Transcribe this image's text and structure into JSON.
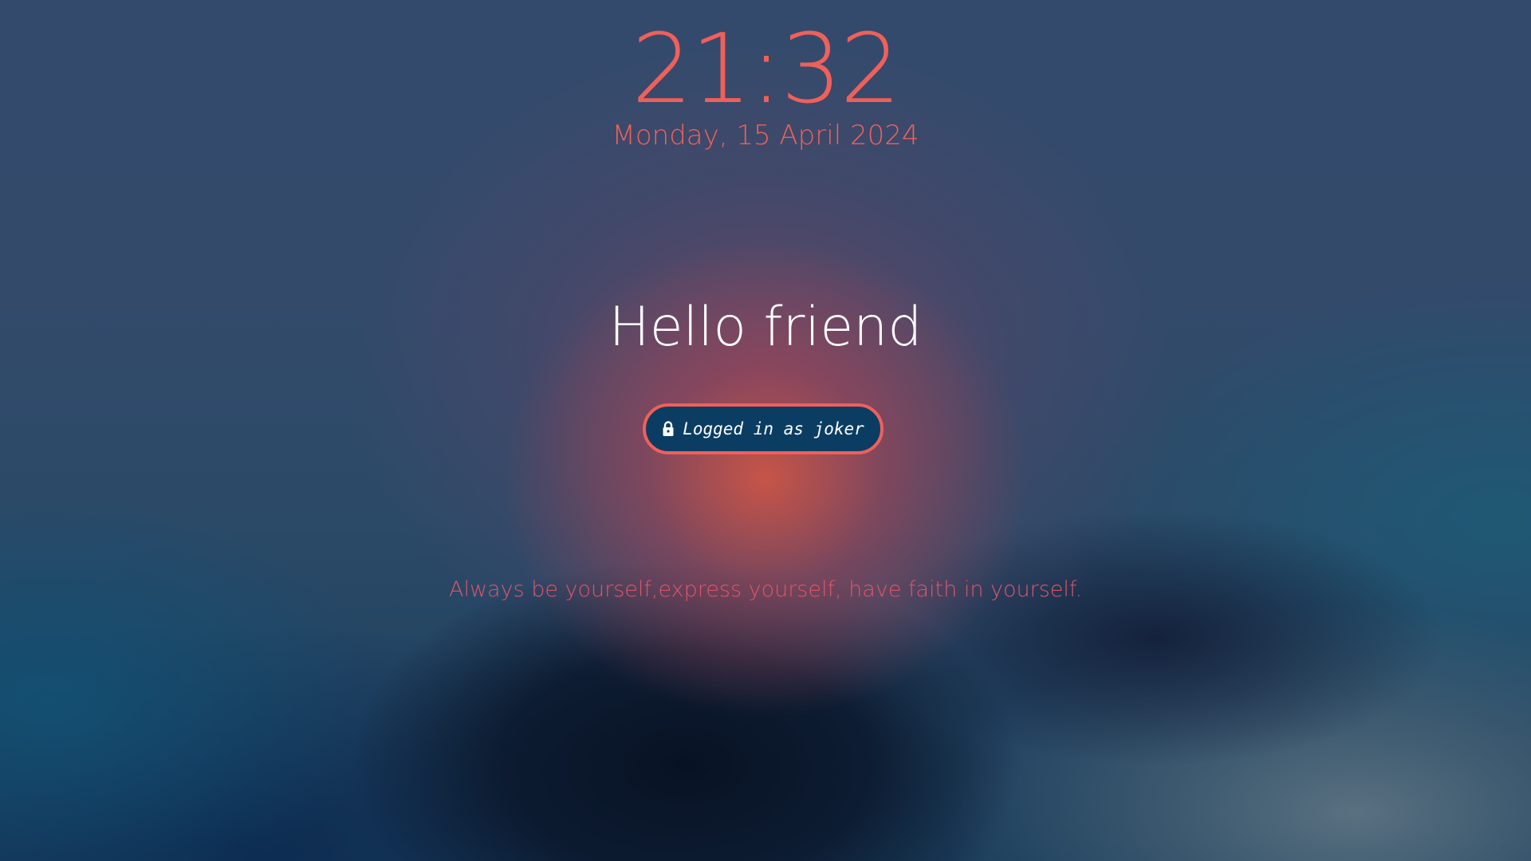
{
  "clock": {
    "time": "21:32",
    "date": "Monday, 15 April 2024"
  },
  "greeting": "Hello friend",
  "login": {
    "label": "Logged in as joker",
    "icon": "lock-icon"
  },
  "quote": "Always be yourself,express yourself, have faith in yourself.",
  "colors": {
    "accent": "#f0605a",
    "quote": "#e0546a",
    "pill_background": "#0b3d63",
    "greeting_text": "#ffffff"
  }
}
